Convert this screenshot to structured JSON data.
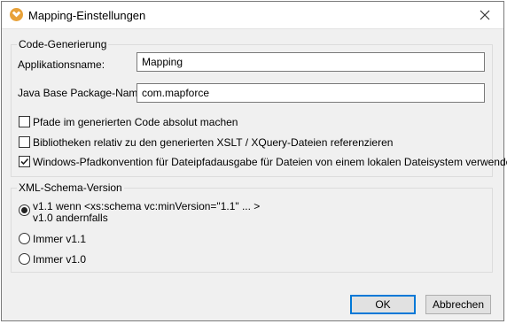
{
  "window": {
    "title": "Mapping-Einstellungen",
    "app_icon": "mapforce-icon",
    "close_icon": "close-icon"
  },
  "code_generation": {
    "group_label": "Code-Generierung",
    "app_name_label": "Applikationsname:",
    "app_name_value": "Mapping",
    "java_package_label": "Java Base Package-Name:",
    "java_package_value": "com.mapforce",
    "options": [
      {
        "label": "Pfade im generierten Code absolut machen",
        "checked": false
      },
      {
        "label": "Bibliotheken relativ zu den generierten XSLT / XQuery-Dateien referenzieren",
        "checked": false
      },
      {
        "label": "Windows-Pfadkonvention für Dateipfadausgabe für Dateien von einem lokalen Dateisystem verwenden",
        "checked": true
      }
    ]
  },
  "xml_schema": {
    "group_label": "XML-Schema-Version",
    "options": [
      {
        "line1": "v1.1 wenn <xs:schema vc:minVersion=\"1.1\" ... >",
        "line2": "v1.0 andernfalls",
        "selected": true
      },
      {
        "label": "Immer v1.1",
        "selected": false
      },
      {
        "label": "Immer v1.0",
        "selected": false
      }
    ]
  },
  "buttons": {
    "ok": "OK",
    "cancel": "Abbrechen"
  },
  "colors": {
    "accent": "#0078d7",
    "icon": "#e8a23a"
  }
}
